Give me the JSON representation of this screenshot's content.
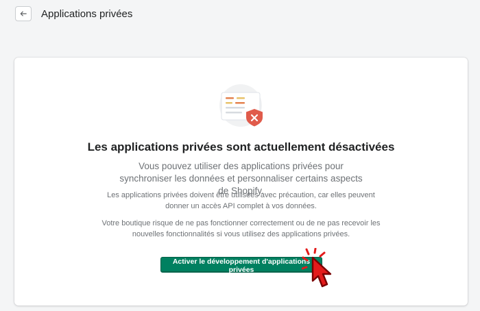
{
  "header": {
    "title": "Applications privées",
    "back_icon": "arrow-left-icon"
  },
  "card": {
    "illustration_icon": "document-shield-error-icon",
    "heading": "Les applications privées sont actuellement désactivées",
    "lead": "Vous pouvez utiliser des applications privées pour synchroniser les données et personnaliser certains aspects de Shopify.",
    "note1": "Les applications privées doivent être utilisées avec précaution, car elles peuvent donner un accès API complet à vos données.",
    "note2": "Votre boutique risque de ne pas fonctionner correctement ou de ne pas recevoir les nouvelles fonctionnalités si vous utilisez des applications privées.",
    "button_label": "Activer le développement d'applications privées"
  },
  "colors": {
    "primary": "#008060",
    "danger": "#e05b4b",
    "background": "#f4f5f6"
  },
  "overlay": {
    "cursor_icon": "hand-pointer-click-icon"
  }
}
